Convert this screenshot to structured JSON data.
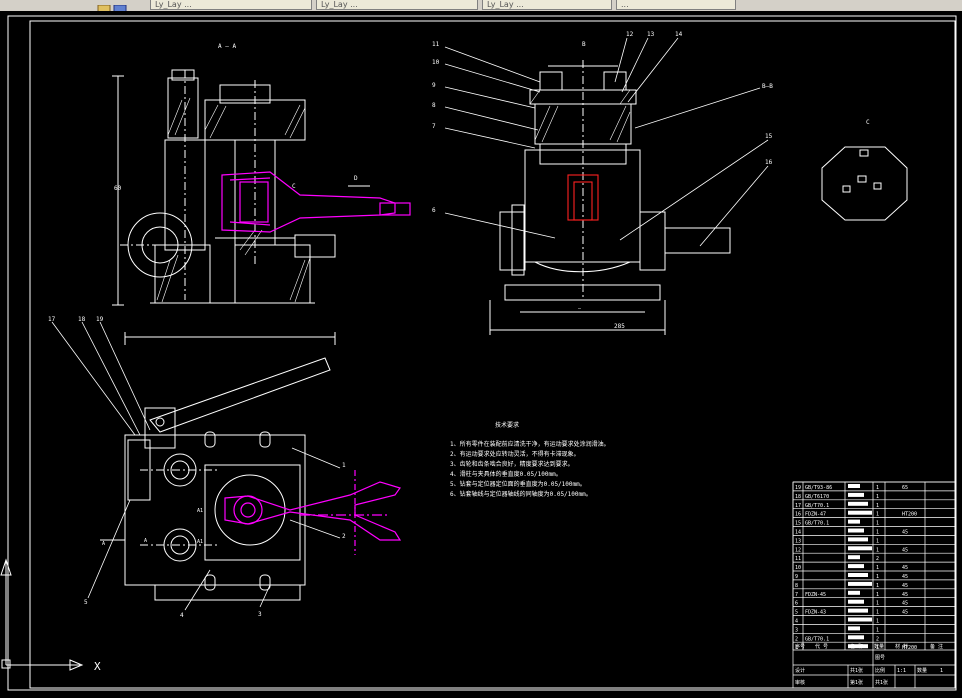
{
  "app": {
    "tabs": [
      {
        "label": "Ly_Lay ..."
      },
      {
        "label": "Ly_Lay ..."
      },
      {
        "label": "Ly_Lay ..."
      },
      {
        "label": "..."
      }
    ]
  },
  "drawing": {
    "section_labels": {
      "aa": "A — A",
      "b": "B",
      "bb": "B–B",
      "c": "C",
      "d": "D",
      "c_arrow": "C",
      "a_left": "A",
      "a1": "A1",
      "a2": "A1",
      "a_mid": "A"
    },
    "dimensions": {
      "width_top": "285",
      "dim_mid": "—",
      "height": "60"
    },
    "callouts": {
      "n1": "1",
      "n2": "2",
      "n3": "3",
      "n4": "4",
      "n5": "5",
      "n6": "6",
      "n7": "7",
      "n8": "8",
      "n9": "9",
      "n10": "10",
      "n11": "11",
      "n12": "12",
      "n13": "13",
      "n14": "14",
      "n15": "15",
      "n16": "16",
      "n17": "17",
      "n18": "18",
      "n19": "19"
    },
    "notes": {
      "title": "技术要求",
      "lines": [
        "1、所有零件在装配前应清洗干净，有运动要求处涂润滑油。",
        "2、有运动要求处应转动灵活，不得有卡滞现象。",
        "3、齿轮和齿条啮合良好，精度要求达到要求。",
        "4、滑柱与夹具体的垂直度0.05/100mm。",
        "5、钻套与定位器定位面的垂直度为0.05/100mm。",
        "6、钻套轴线与定位器轴线的同轴度为0.05/100mm。"
      ]
    },
    "axis": {
      "x": "X",
      "y": "Y"
    }
  },
  "bom": {
    "rows": [
      {
        "no": "19",
        "code": "GB/T93-86",
        "qty": "1",
        "mat": "65"
      },
      {
        "no": "18",
        "code": "GB/T6170",
        "qty": "1",
        "mat": ""
      },
      {
        "no": "17",
        "code": "GB/T70.1",
        "qty": "1",
        "mat": ""
      },
      {
        "no": "16",
        "code": "FDZN-47",
        "qty": "1",
        "mat": "HT200"
      },
      {
        "no": "15",
        "code": "GB/T70.1",
        "qty": "1",
        "mat": ""
      },
      {
        "no": "14",
        "code": "",
        "qty": "1",
        "mat": "45"
      },
      {
        "no": "13",
        "code": "",
        "qty": "1",
        "mat": ""
      },
      {
        "no": "12",
        "code": "",
        "qty": "1",
        "mat": "45"
      },
      {
        "no": "11",
        "code": "",
        "qty": "2",
        "mat": ""
      },
      {
        "no": "10",
        "code": "",
        "qty": "1",
        "mat": "45"
      },
      {
        "no": "9",
        "code": "",
        "qty": "1",
        "mat": "45"
      },
      {
        "no": "8",
        "code": "",
        "qty": "1",
        "mat": "45"
      },
      {
        "no": "7",
        "code": "FDZN-45",
        "qty": "1",
        "mat": "45"
      },
      {
        "no": "6",
        "code": "",
        "qty": "1",
        "mat": "45"
      },
      {
        "no": "5",
        "code": "FDZN-43",
        "qty": "1",
        "mat": "45"
      },
      {
        "no": "4",
        "code": "",
        "qty": "1",
        "mat": ""
      },
      {
        "no": "3",
        "code": "",
        "qty": "1",
        "mat": ""
      },
      {
        "no": "2",
        "code": "GB/T70.1",
        "qty": "2",
        "mat": ""
      },
      {
        "no": "1",
        "code": "",
        "qty": "1",
        "mat": "HT200"
      }
    ],
    "header": [
      "序号",
      "代 号",
      "名 称",
      "数量",
      "材 料",
      "备 注"
    ],
    "title_block": {
      "r1a": "图号",
      "r1b": "比例",
      "r1c": "1:1",
      "r1d": "数量",
      "r1e": "1",
      "r2a": "设计",
      "r2b": "共1张",
      "r2c": "第1张",
      "r3a": "审核",
      "r3b": "共1张"
    }
  },
  "colors": {
    "bg": "#000000",
    "line": "#ffffff",
    "section": "#ff00ff",
    "hidden": "#ff2020"
  }
}
